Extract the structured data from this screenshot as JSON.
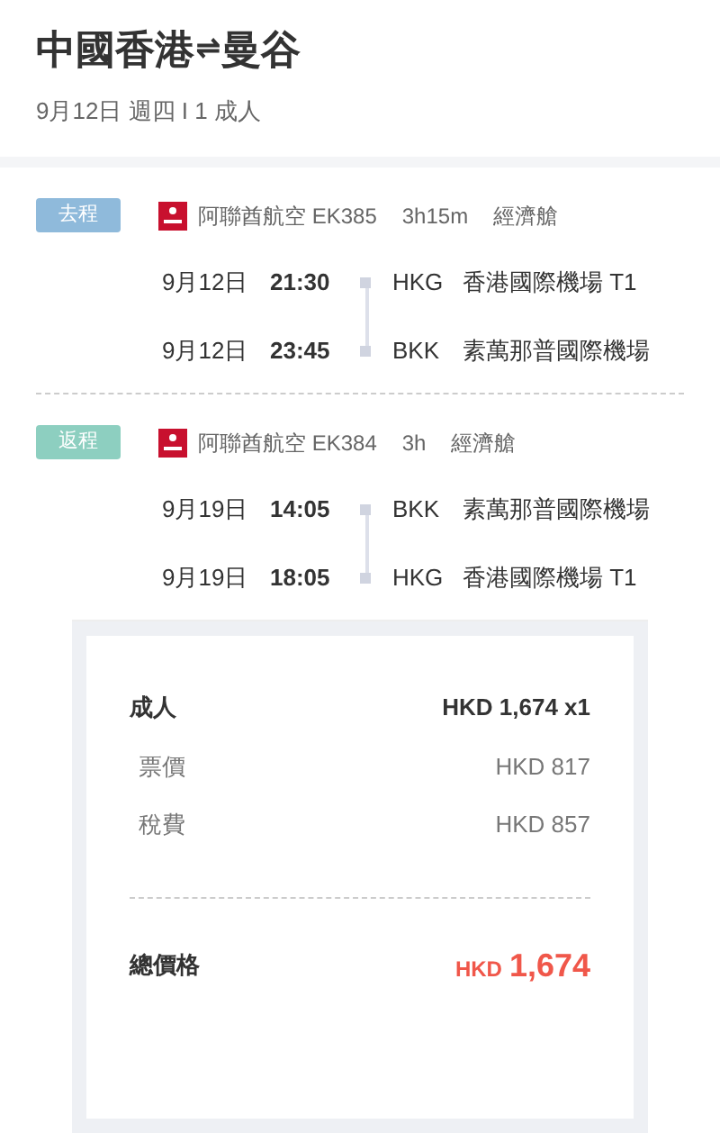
{
  "header": {
    "origin": "中國香港",
    "arrow": "⇌",
    "destination": "曼谷",
    "subtitle": "9月12日 週四 I 1 成人"
  },
  "segments": [
    {
      "tag": "去程",
      "color": "#8fbadb",
      "airline": "阿聯酋航空 EK385",
      "duration": "3h15m",
      "cabin": "經濟艙",
      "stops": [
        {
          "date": "9月12日",
          "time": "21:30",
          "code": "HKG",
          "airport": "香港國際機場 T1"
        },
        {
          "date": "9月12日",
          "time": "23:45",
          "code": "BKK",
          "airport": "素萬那普國際機場"
        }
      ]
    },
    {
      "tag": "返程",
      "color": "#8dcfc0",
      "airline": "阿聯酋航空 EK384",
      "duration": "3h",
      "cabin": "經濟艙",
      "stops": [
        {
          "date": "9月19日",
          "time": "14:05",
          "code": "BKK",
          "airport": "素萬那普國際機場"
        },
        {
          "date": "9月19日",
          "time": "18:05",
          "code": "HKG",
          "airport": "香港國際機場 T1"
        }
      ]
    }
  ],
  "price": {
    "passenger": "成人",
    "passenger_total": "HKD 1,674 x1",
    "items": [
      {
        "label": "票價",
        "amount": "HKD 817"
      },
      {
        "label": "稅費",
        "amount": "HKD 857"
      }
    ],
    "total_label": "總價格",
    "currency": "HKD",
    "total": "1,674"
  }
}
